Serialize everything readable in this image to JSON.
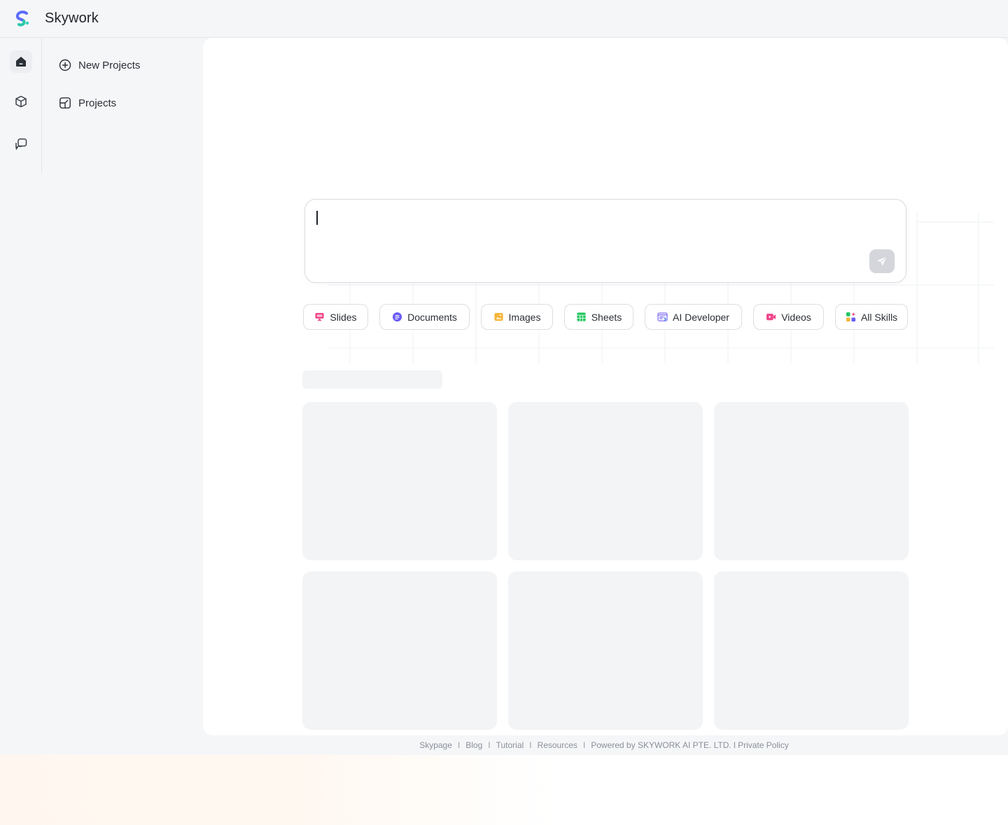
{
  "app": {
    "brand": "Skywork"
  },
  "rail": {
    "items": [
      {
        "name": "home",
        "icon": "home-icon",
        "active": true
      },
      {
        "name": "cube",
        "icon": "cube-icon",
        "active": false
      },
      {
        "name": "chat",
        "icon": "chat-icon",
        "active": false
      }
    ]
  },
  "sidebar": {
    "items": [
      {
        "label": "New Projects",
        "icon": "plus-circle-icon"
      },
      {
        "label": "Projects",
        "icon": "projects-icon"
      }
    ]
  },
  "prompt": {
    "value": "",
    "placeholder": ""
  },
  "skills": [
    {
      "label": "Slides",
      "icon": "slides-icon",
      "color": "#f0478b"
    },
    {
      "label": "Documents",
      "icon": "documents-icon",
      "color": "#6b5cf6"
    },
    {
      "label": "Images",
      "icon": "images-icon",
      "color": "#f5b53a"
    },
    {
      "label": "Sheets",
      "icon": "sheets-icon",
      "color": "#22c55e"
    },
    {
      "label": "AI Developer",
      "icon": "ai-developer-icon",
      "color": "#7c6cf0"
    },
    {
      "label": "Videos",
      "icon": "videos-icon",
      "color": "#f0478b"
    },
    {
      "label": "All Skills",
      "icon": "all-skills-icon",
      "color": "#f0478b"
    }
  ],
  "footer": {
    "links": [
      "Skypage",
      "Blog",
      "Tutorial",
      "Resources"
    ],
    "powered": "Powered by SKYWORK AI PTE. LTD.",
    "privacy": "Private Policy"
  },
  "colors": {
    "background": "#f5f6f8",
    "panel": "#ffffff",
    "skeleton": "#f3f4f6",
    "send_disabled": "#d4d6db"
  }
}
